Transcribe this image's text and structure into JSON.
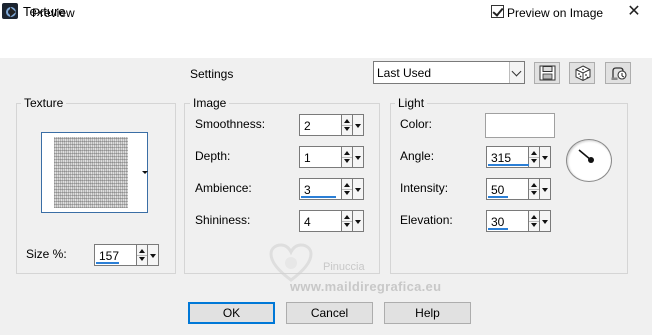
{
  "window": {
    "title": "Texture",
    "close_glyph": "✕"
  },
  "preview": {
    "label": "Preview",
    "preview_on_image_label": "Preview on Image",
    "preview_on_image_checked": true
  },
  "settings": {
    "label": "Settings",
    "preset_value": "Last Used",
    "toolbar_icons": [
      "save-preset-icon",
      "randomize-dice-icon",
      "reset-icon"
    ]
  },
  "texture_group": {
    "title": "Texture",
    "size_label": "Size %:",
    "size_value": "157"
  },
  "image_group": {
    "title": "Image",
    "fields": [
      {
        "label": "Smoothness:",
        "value": "2"
      },
      {
        "label": "Depth:",
        "value": "1"
      },
      {
        "label": "Ambience:",
        "value": "3"
      },
      {
        "label": "Shininess:",
        "value": "4"
      }
    ]
  },
  "light_group": {
    "title": "Light",
    "color_label": "Color:",
    "color_value": "#ffffff",
    "angle_label": "Angle:",
    "angle_value": "315",
    "intensity_label": "Intensity:",
    "intensity_value": "50",
    "elevation_label": "Elevation:",
    "elevation_value": "30"
  },
  "watermark": {
    "name": "Pinuccia",
    "url": "www.maildiregrafica.eu"
  },
  "buttons": {
    "ok": "OK",
    "cancel": "Cancel",
    "help": "Help"
  },
  "colors": {
    "accent": "#0078d7",
    "spin_bar": "#2b7fd6"
  }
}
